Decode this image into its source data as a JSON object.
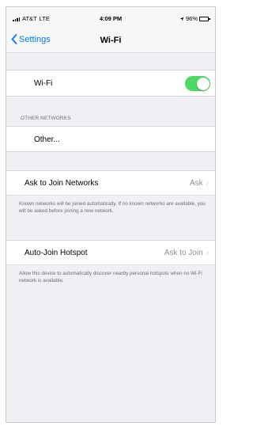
{
  "status_bar": {
    "carrier": "AT&T",
    "network": "LTE",
    "time": "4:09 PM",
    "battery": "96%",
    "battery_color": "#4cd964",
    "location_icon": "location-arrow-icon"
  },
  "nav": {
    "back_label": "Settings",
    "title": "Wi-Fi"
  },
  "wifi_row": {
    "label": "Wi-Fi",
    "toggle_on": true
  },
  "networks": {
    "section_header": "OTHER NETWORKS",
    "other_label": "Other..."
  },
  "ask_to_join": {
    "label": "Ask to Join Networks",
    "value": "Ask",
    "footnote": "Known networks will be joined automatically. If no known networks are available, you will be asked before joining a new network."
  },
  "auto_join": {
    "label": "Auto-Join Hotspot",
    "value": "Ask to Join",
    "footnote": "Allow this device to automatically discover nearby personal hotspots when no Wi-Fi network is available."
  },
  "colors": {
    "accent": "#007aff",
    "toggle_on": "#4cd964",
    "background": "#efeff4"
  }
}
